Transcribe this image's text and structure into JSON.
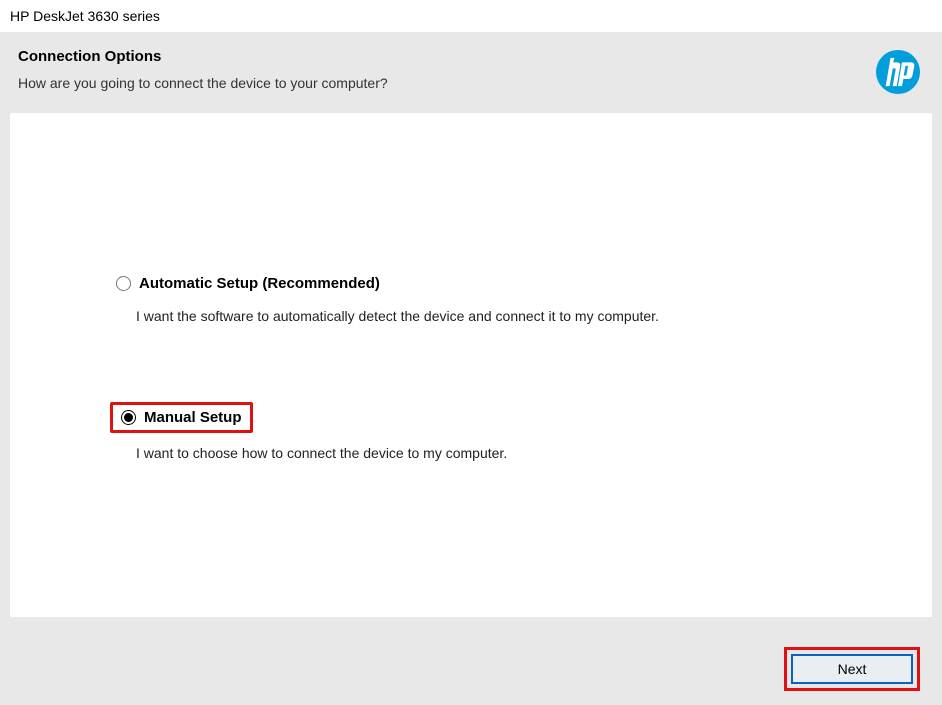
{
  "window": {
    "title": "HP DeskJet 3630 series"
  },
  "header": {
    "heading": "Connection Options",
    "subheading": "How are you going to connect the device to your computer?"
  },
  "options": {
    "auto": {
      "label": "Automatic Setup (Recommended)",
      "desc": "I want the software to automatically detect the device and connect it to my computer."
    },
    "manual": {
      "label": "Manual Setup",
      "desc": "I want to choose how to connect the device to my computer."
    },
    "selected": "manual"
  },
  "footer": {
    "next": "Next"
  },
  "brand": {
    "color": "#009fdb"
  }
}
